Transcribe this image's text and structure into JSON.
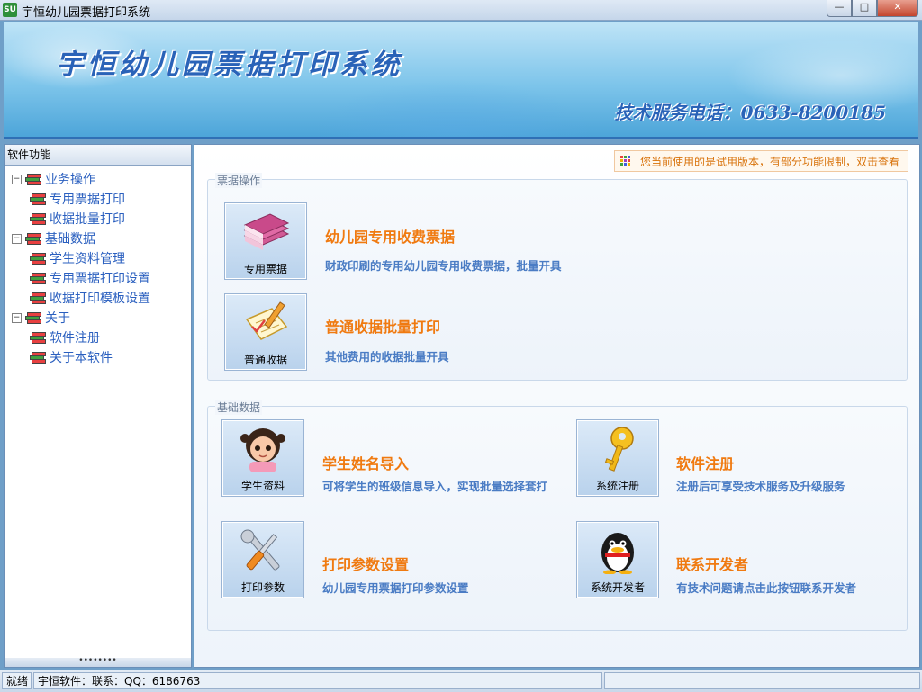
{
  "window": {
    "title": "宇恒幼儿园票据打印系统",
    "icon_text": "SU",
    "controls": {
      "minimize": "—",
      "maximize": "□",
      "close": "✕"
    }
  },
  "banner": {
    "title": "宇恒幼儿园票据打印系统",
    "phone": "技术服务电话：0633-8200185"
  },
  "sidebar": {
    "header": "软件功能",
    "tree": [
      {
        "label": "业务操作",
        "expander": "−",
        "children": [
          {
            "label": "专用票据打印"
          },
          {
            "label": "收据批量打印"
          }
        ]
      },
      {
        "label": "基础数据",
        "expander": "−",
        "children": [
          {
            "label": "学生资料管理"
          },
          {
            "label": "专用票据打印设置"
          },
          {
            "label": "收据打印模板设置"
          }
        ]
      },
      {
        "label": "关于",
        "expander": "−",
        "children": [
          {
            "label": "软件注册"
          },
          {
            "label": "关于本软件"
          }
        ]
      }
    ],
    "footer_grip": "••••••••"
  },
  "main": {
    "trial_notice": "您当前使用的是试用版本，有部分功能限制，双击查看",
    "groups": {
      "receipts": {
        "label": "票据操作",
        "items": [
          {
            "tile_label": "专用票据",
            "icon": "books-stack-icon",
            "title": "幼儿园专用收费票据",
            "desc": "财政印刷的专用幼儿园专用收费票据，批量开具"
          },
          {
            "tile_label": "普通收据",
            "icon": "notepad-pencil-icon",
            "title": "普通收据批量打印",
            "desc": "其他费用的收据批量开具"
          }
        ]
      },
      "basic": {
        "label": "基础数据",
        "items": [
          {
            "tile_label": "学生资料",
            "icon": "child-avatar-icon",
            "title": "学生姓名导入",
            "desc": "可将学生的班级信息导入，实现批量选择套打"
          },
          {
            "tile_label": "系统注册",
            "icon": "key-icon",
            "title": "软件注册",
            "desc": "注册后可享受技术服务及升级服务"
          },
          {
            "tile_label": "打印参数",
            "icon": "wrench-screwdriver-icon",
            "title": "打印参数设置",
            "desc": "幼儿园专用票据打印参数设置"
          },
          {
            "tile_label": "系统开发者",
            "icon": "penguin-icon",
            "title": "联系开发者",
            "desc": "有技术问题请点击此按钮联系开发者"
          }
        ]
      }
    }
  },
  "statusbar": {
    "state": "就绪",
    "contact": "宇恒软件：联系：QQ：6186763"
  },
  "colors": {
    "accent_orange": "#f07a10",
    "link_blue": "#4a7cc4",
    "tree_blue": "#2a5fbf",
    "banner_text": "#2a63b8"
  }
}
